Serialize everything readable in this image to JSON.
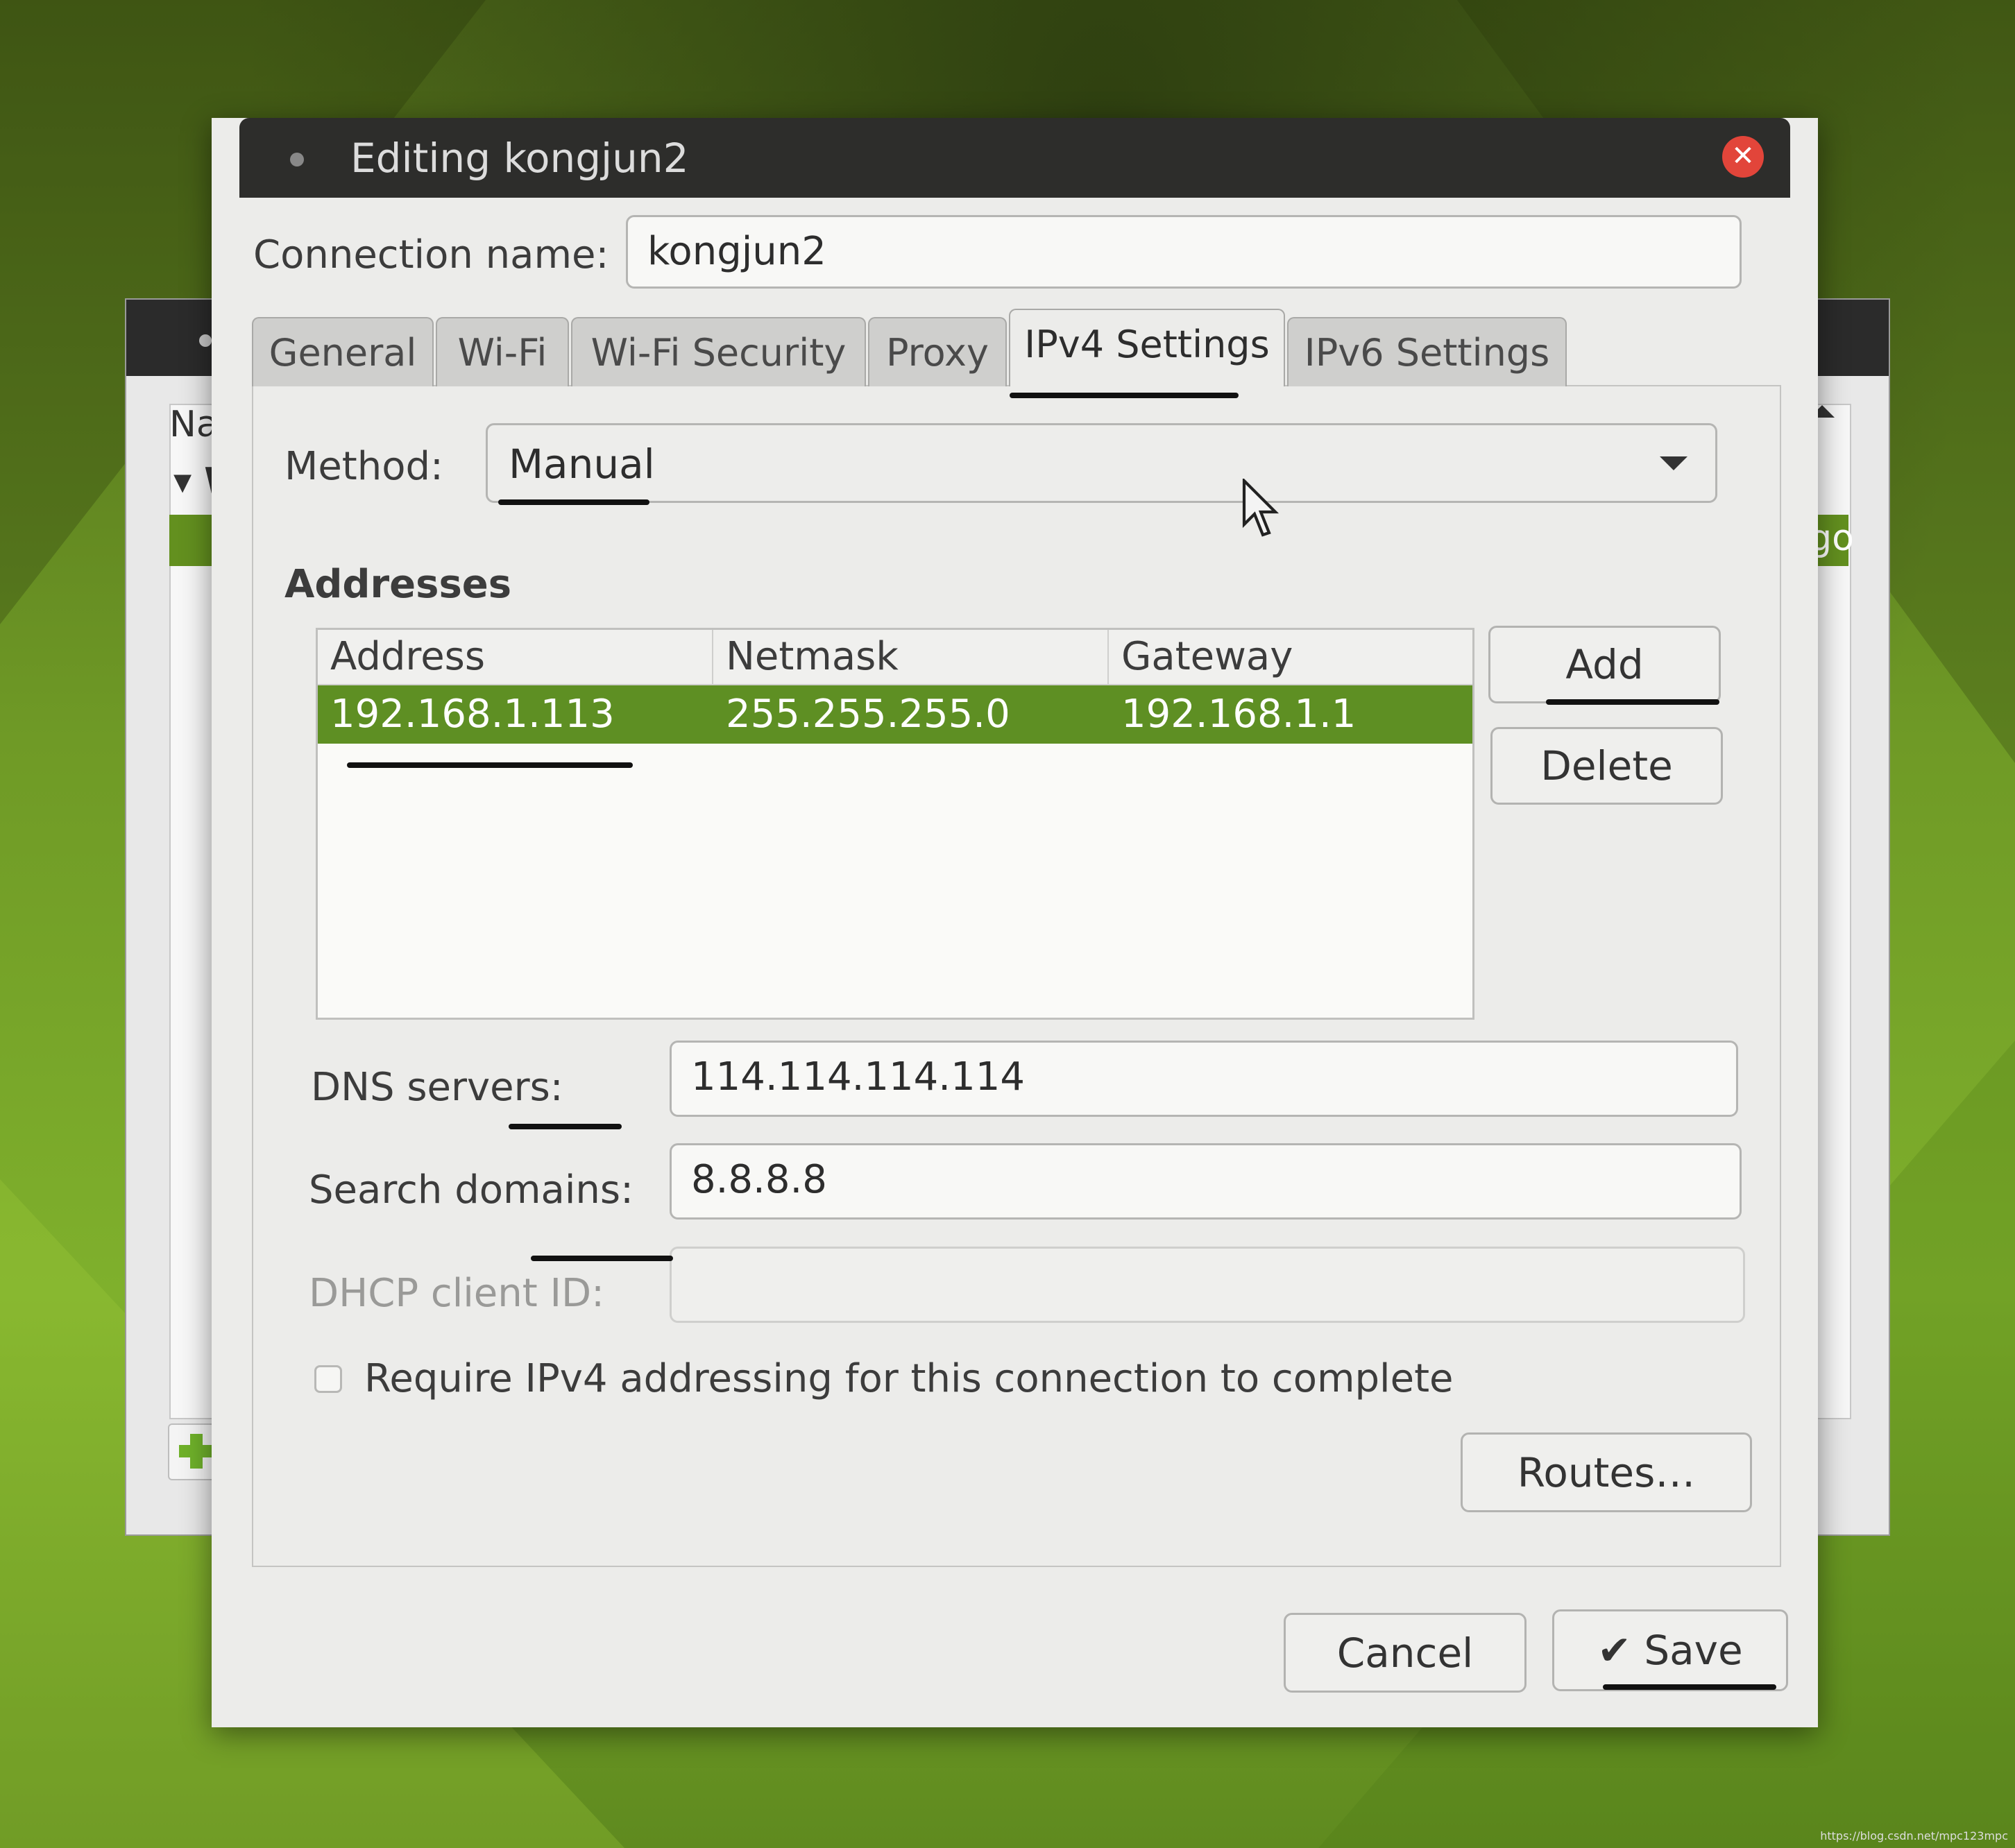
{
  "background_window": {
    "column_header": "Na",
    "tree_row": "W",
    "selected_text": "go"
  },
  "dialog": {
    "title": "Editing kongjun2",
    "close_icon": "close-icon",
    "connection_name_label": "Connection name:",
    "connection_name_value": "kongjun2",
    "tabs": [
      {
        "label": "General"
      },
      {
        "label": "Wi-Fi"
      },
      {
        "label": "Wi-Fi Security"
      },
      {
        "label": "Proxy"
      },
      {
        "label": "IPv4 Settings"
      },
      {
        "label": "IPv6 Settings"
      }
    ],
    "active_tab": "IPv4 Settings",
    "method_label": "Method:",
    "method_value": "Manual",
    "addresses_heading": "Addresses",
    "table": {
      "columns": [
        "Address",
        "Netmask",
        "Gateway"
      ],
      "rows": [
        {
          "address": "192.168.1.113",
          "netmask": "255.255.255.0",
          "gateway": "192.168.1.1"
        }
      ]
    },
    "add_label": "Add",
    "delete_label": "Delete",
    "dns_label": "DNS servers:",
    "dns_value": "114.114.114.114",
    "search_label": "Search domains:",
    "search_value": "8.8.8.8",
    "dhcp_label": "DHCP client ID:",
    "dhcp_value": "",
    "require_label": "Require IPv4 addressing for this connection to complete",
    "require_checked": false,
    "routes_label": "Routes…",
    "cancel_label": "Cancel",
    "save_label": "Save",
    "save_icon": "checkmark-icon"
  },
  "colors": {
    "selection": "#5e8f23",
    "titlebar": "#2d2d2b",
    "close": "#e2453a",
    "desktop": "#7fb02c"
  },
  "watermark": "https://blog.csdn.net/mpc123mpc"
}
